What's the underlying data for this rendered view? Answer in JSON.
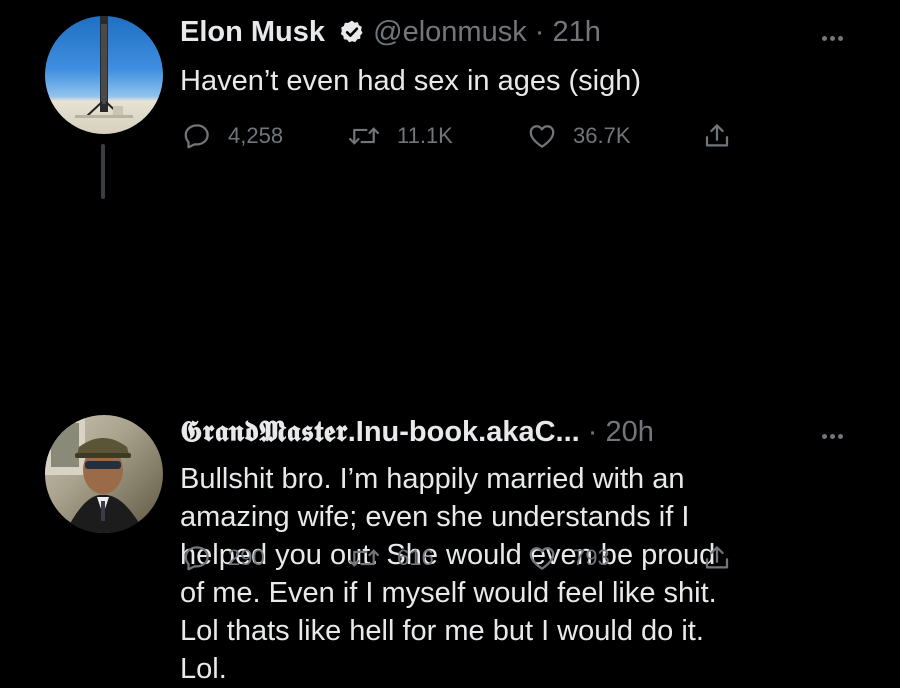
{
  "tweets": [
    {
      "display_name": "Elon Musk",
      "verified": true,
      "handle": "@elonmusk",
      "separator": "·",
      "time": "21h",
      "text": "Haven’t even had sex in ages (sigh)",
      "replies": "4,258",
      "retweets": "11.1K",
      "likes": "36.7K"
    },
    {
      "display_name_fancy": "𝕲𝖗𝖆𝖓𝖉𝕸𝖆𝖘𝖙𝖊𝖗",
      "display_name_rest": ".Inu-book.akaC...",
      "separator": "·",
      "time": "20h",
      "text": "Bullshit bro. I’m happily married with an\namazing wife; even she understands if I\nhelped you out. She would even be proud\nof me. Even if I myself would feel like shit.\nLol thats like hell for me but I would do it.\nLol.",
      "replies": "290",
      "retweets": "616",
      "likes": "793"
    }
  ],
  "icons": {
    "reply": "reply-icon",
    "retweet": "retweet-icon",
    "like": "heart-icon",
    "share": "share-icon",
    "more": "more-icon",
    "verified": "verified-badge-icon"
  },
  "colors": {
    "background": "#000000",
    "text": "#e7e9ea",
    "secondary": "#71767b",
    "thread_line": "#3a3d41"
  }
}
